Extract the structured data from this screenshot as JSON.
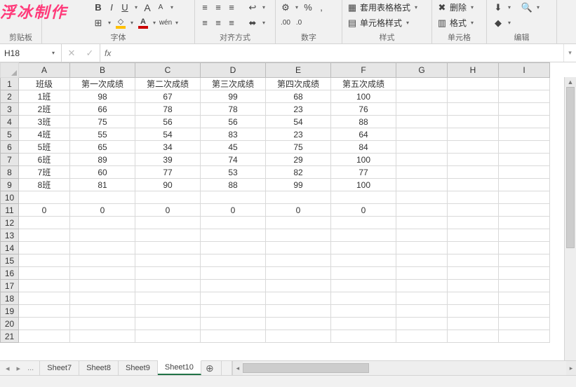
{
  "watermark": "浮冰制作",
  "ribbon": {
    "clipboard": {
      "label": "剪贴板"
    },
    "font": {
      "label": "字体",
      "bold": "B",
      "italic": "I",
      "underline": "U",
      "border": "⊞",
      "grow": "A",
      "shrink": "A",
      "wen": "wén"
    },
    "align": {
      "label": "对齐方式"
    },
    "number": {
      "label": "数字",
      "pct": "%",
      "comma": ","
    },
    "styles": {
      "label": "样式",
      "tablefmt": "套用表格格式",
      "cellstyle": "单元格样式"
    },
    "cells": {
      "label": "单元格",
      "delete": "删除",
      "format": "格式"
    },
    "edit": {
      "label": "编辑"
    }
  },
  "namebox": {
    "ref": "H18",
    "fx": "fx"
  },
  "columns": [
    "A",
    "B",
    "C",
    "D",
    "E",
    "F",
    "G",
    "H",
    "I"
  ],
  "chart_data": {
    "type": "table",
    "headers": [
      "班级",
      "第一次成绩",
      "第二次成绩",
      "第三次成绩",
      "第四次成绩",
      "第五次成绩"
    ],
    "rows": [
      [
        "1班",
        98,
        67,
        99,
        68,
        100
      ],
      [
        "2班",
        66,
        78,
        78,
        23,
        76
      ],
      [
        "3班",
        75,
        56,
        56,
        54,
        88
      ],
      [
        "4班",
        55,
        54,
        83,
        23,
        64
      ],
      [
        "5班",
        65,
        34,
        45,
        75,
        84
      ],
      [
        "6班",
        89,
        39,
        74,
        29,
        100
      ],
      [
        "7班",
        60,
        77,
        53,
        82,
        77
      ],
      [
        "8班",
        81,
        90,
        88,
        99,
        100
      ]
    ],
    "footer": [
      0,
      0,
      0,
      0,
      0,
      0
    ]
  },
  "sheets": {
    "tabs": [
      "Sheet7",
      "Sheet8",
      "Sheet9",
      "Sheet10"
    ],
    "activeIndex": 3,
    "ellipsis": "...",
    "add": "⊕"
  }
}
